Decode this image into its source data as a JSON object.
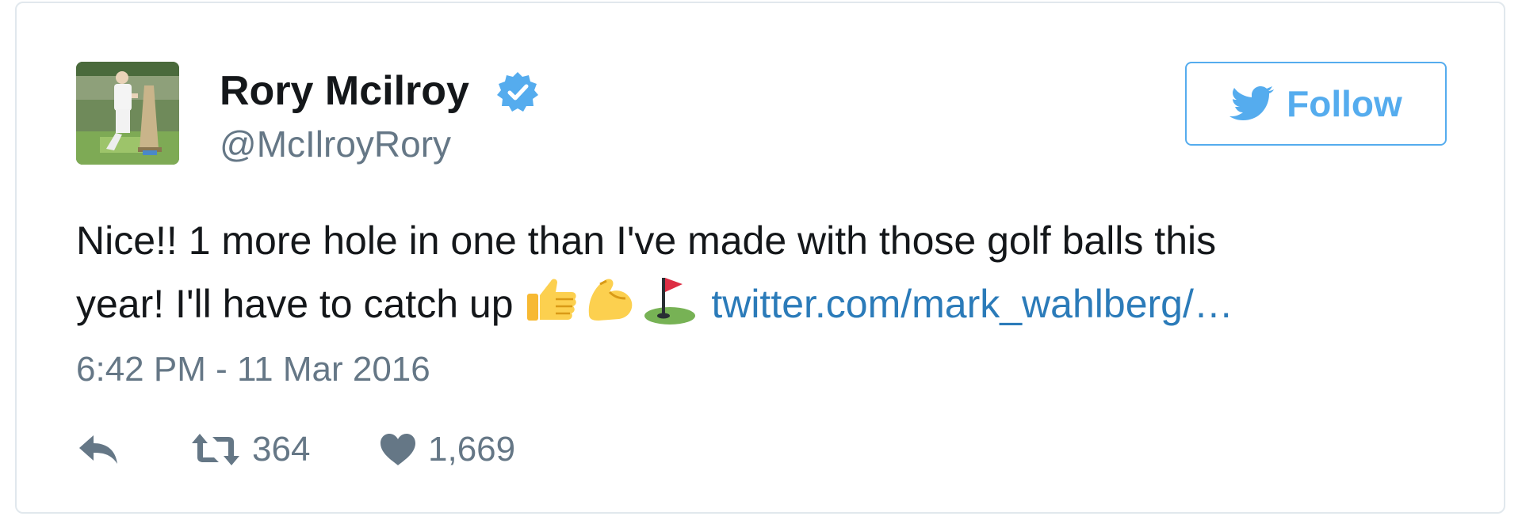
{
  "tweet": {
    "author": {
      "name": "Rory Mcilroy",
      "handle": "@McIlroyRory",
      "verified": true,
      "avatar": "golfer-kneeling-with-trophy"
    },
    "follow_label": "Follow",
    "text_line1": "Nice!! 1 more hole in one than I've made with those golf balls this",
    "text_line2_before": "year! I'll have to catch up ",
    "emojis": [
      "thumbs-up-emoji",
      "flexed-biceps-emoji",
      "flag-in-hole-emoji"
    ],
    "link_text": "twitter.com/mark_wahlberg/…",
    "timestamp": "6:42 PM - 11 Mar 2016",
    "actions": {
      "reply_icon": "reply-icon",
      "retweet_icon": "retweet-icon",
      "retweet_count": "364",
      "like_icon": "heart-icon",
      "like_count": "1,669"
    }
  },
  "colors": {
    "text": "#14171a",
    "muted": "#657786",
    "link": "#2b7bb9",
    "brand": "#55acee",
    "border": "#e1e8ed"
  }
}
